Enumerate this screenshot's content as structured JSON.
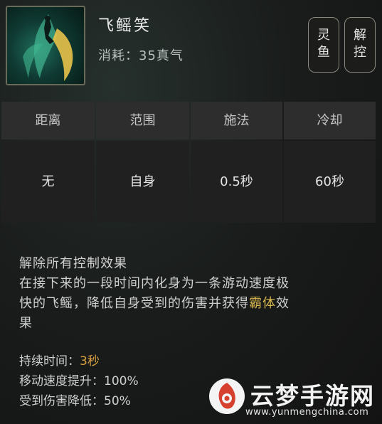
{
  "skill": {
    "name": "飞鳐笑",
    "cost": "消耗：35真气",
    "icon": "flying-ray-icon"
  },
  "tags": [
    {
      "line1": "灵",
      "line2": "鱼"
    },
    {
      "line1": "解",
      "line2": "控"
    }
  ],
  "stats": {
    "headers": [
      "距离",
      "范围",
      "施法",
      "冷却"
    ],
    "values": [
      "无",
      "自身",
      "0.5秒",
      "60秒"
    ]
  },
  "description": {
    "line1": "解除所有控制效果",
    "line2": "在接下来的一段时间内化身为一条游动速度极",
    "line3_a": "快的飞鳐，降低自身受到的伤害并获得",
    "line3_hl": "霸体",
    "line3_b": "效",
    "line4": "果"
  },
  "attributes": {
    "duration_label": "持续时间：",
    "duration_value": "3秒",
    "speed_label": "移动速度提升：",
    "speed_value": "100%",
    "damage_label": "受到伤害降低：",
    "damage_value": "50%"
  },
  "colors": {
    "highlight": "#d9b84e",
    "value_gold": "#d9a040",
    "header_bg": "#2d2d2d",
    "cell_bg": "#202020"
  },
  "watermark": {
    "title": "云梦手游网",
    "url": "www.yunmengchina.com"
  }
}
